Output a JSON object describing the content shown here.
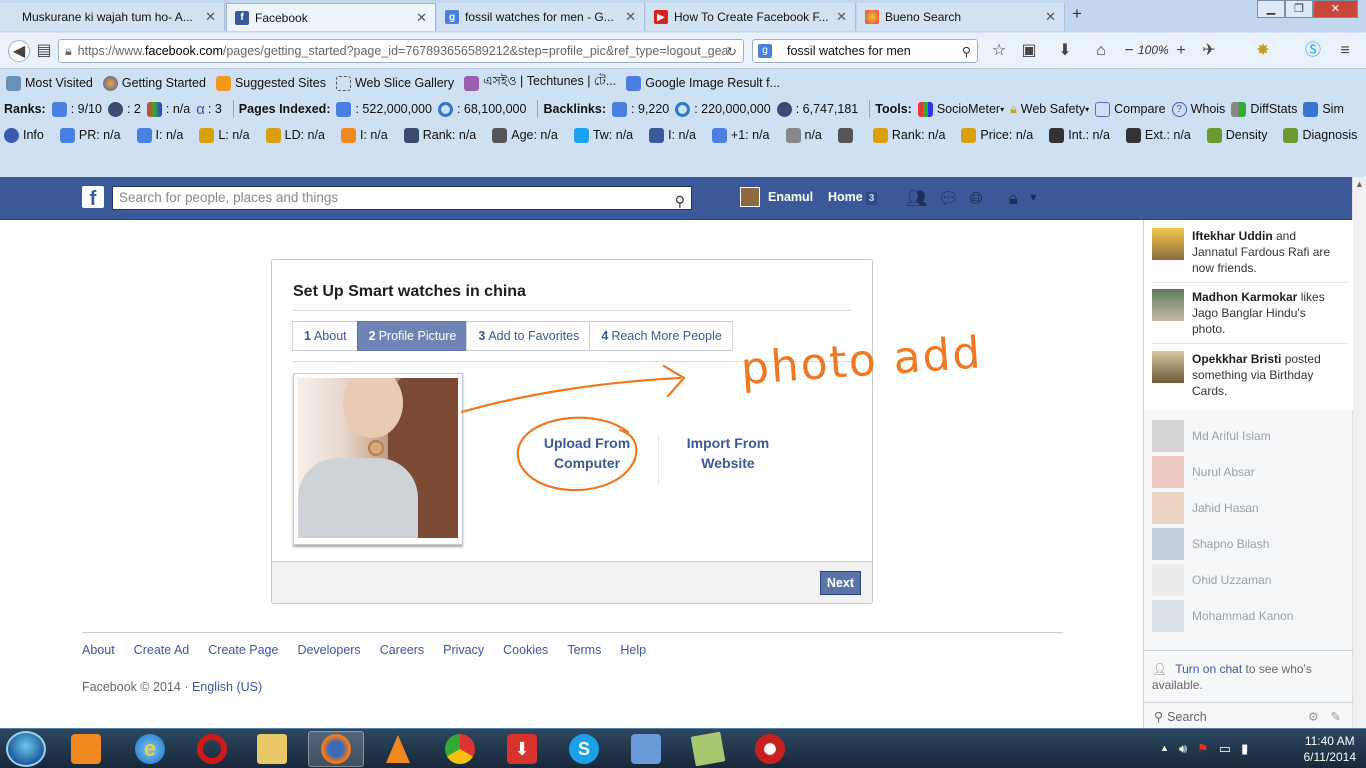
{
  "browser": {
    "tabs": [
      {
        "title": "Muskurane ki wajah tum ho- A...",
        "icon": "youtube-icon",
        "active": false
      },
      {
        "title": "Facebook",
        "icon": "facebook-icon",
        "active": true
      },
      {
        "title": "fossil watches for men - G...",
        "icon": "google-icon",
        "active": false
      },
      {
        "title": "How To Create Facebook F...",
        "icon": "youtube-icon",
        "active": false
      },
      {
        "title": "Bueno Search",
        "icon": "bueno-icon",
        "active": false
      }
    ],
    "url_host": "https://www.",
    "url_domain": "facebook.com",
    "url_path": "/pages/getting_started?page_id=767893656589212&step=profile_pic&ref_type=logout_gea",
    "search_value": "fossil watches for men",
    "zoom": "100%"
  },
  "bookmarks": [
    "Most Visited",
    "Getting Started",
    "Suggested Sites",
    "Web Slice Gallery",
    "এসইও | Techtunes | টে...",
    "Google Image Result f..."
  ],
  "seoquake1": {
    "ranks_label": "Ranks:",
    "rank1": ": 9/10",
    "rank2": ": 2",
    "rank3": ": n/a",
    "rank4": ": 3",
    "pages_indexed_label": "Pages Indexed:",
    "pi1": ": 522,000,000",
    "pi2": ": 68,100,000",
    "backlinks_label": "Backlinks:",
    "bl1": ": 9,220",
    "bl2": ": 220,000,000",
    "bl3": ": 6,747,181",
    "tools_label": "Tools:",
    "sociometer": "SocioMeter",
    "web_safety": "Web Safety",
    "compare": "Compare",
    "whois": "Whois",
    "diffstats": "DiffStats",
    "sim": "Sim"
  },
  "seoquake2": [
    "Info",
    "PR: n/a",
    "I: n/a",
    "L: n/a",
    "LD: n/a",
    "I: n/a",
    "Rank: n/a",
    "Age: n/a",
    "Tw: n/a",
    "I: n/a",
    "+1: n/a",
    "n/a",
    "",
    "Rank: n/a",
    "Price: n/a",
    "Int.: n/a",
    "Ext.: n/a",
    "Density",
    "Diagnosis"
  ],
  "fb": {
    "search_placeholder": "Search for people, places and things",
    "user_name": "Enamul",
    "home_label": "Home",
    "home_count": "3"
  },
  "setup": {
    "title": "Set Up Smart watches in china",
    "steps": [
      {
        "num": "1",
        "label": "About",
        "active": false
      },
      {
        "num": "2",
        "label": "Profile Picture",
        "active": true
      },
      {
        "num": "3",
        "label": "Add to Favorites",
        "active": false
      },
      {
        "num": "4",
        "label": "Reach More People",
        "active": false
      }
    ],
    "upload_line1": "Upload From",
    "upload_line2": "Computer",
    "import_line1": "Import From",
    "import_line2": "Website",
    "next_label": "Next",
    "annotation_text": "photo add"
  },
  "footer": {
    "links": [
      "About",
      "Create Ad",
      "Create Page",
      "Developers",
      "Careers",
      "Privacy",
      "Cookies",
      "Terms",
      "Help"
    ],
    "copyright": "Facebook © 2014 · ",
    "language": "English (US)"
  },
  "ticker": [
    {
      "name": "Iftekhar Uddin",
      "text1": " and",
      "text2": "Jannatul Fardous Rafi are",
      "text3": "now friends."
    },
    {
      "name": "Madhon Karmokar",
      "text1": " likes",
      "text2": "Jago Banglar Hindu's",
      "text3": "photo."
    },
    {
      "name": "Opekkhar Bristi",
      "text1": " posted",
      "text2": "something via Birthday",
      "text3": "Cards."
    }
  ],
  "chat": [
    "Md Ariful Islam",
    "Nurul Absar",
    "Jahid Hasan",
    "Shapno Bilash",
    "Ohid Uzzaman",
    "Mohammad Kanon"
  ],
  "chat_footer": {
    "turn_on": "Turn on chat",
    "rest": " to see who's available.",
    "search": "Search"
  },
  "taskbar": {
    "time": "11:40 AM",
    "date": "6/11/2014"
  },
  "colors": {
    "fb_blue": "#3b5998",
    "annotation_orange": "#f07820"
  }
}
